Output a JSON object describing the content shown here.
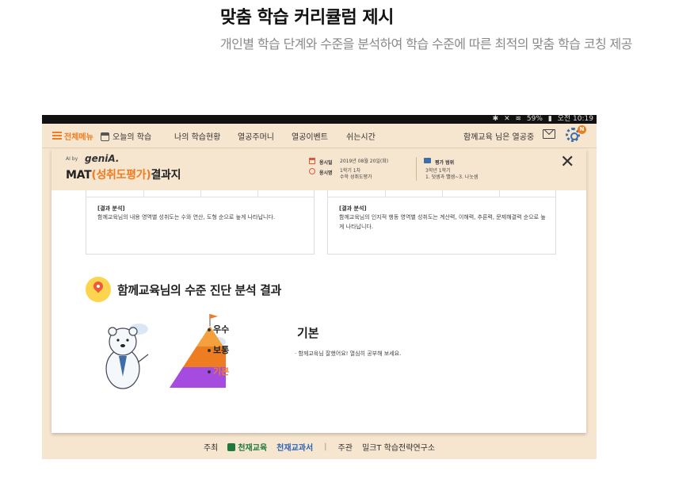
{
  "headline": "맞춤 학습 커리큘럼 제시",
  "subhead": "개인별 학습 단계와 수준을 분석하여 학습 수준에 따른 최적의 맞춤 학습 코칭 제공",
  "statusbar": {
    "battery": "59%",
    "time": "오전 10:19"
  },
  "nav": {
    "menu_label": "전체메뉴",
    "items": [
      "오늘의 학습",
      "나의 학습현황",
      "열공주머니",
      "열공이벤트",
      "쉬는시간"
    ],
    "user_greeting": "함께교육 님은 열공중",
    "notification_badge": "N"
  },
  "report": {
    "brand_small": "AI by",
    "brand_logo": "geniA.",
    "title_prefix": "MAT",
    "title_accent": "(성취도평가)",
    "title_suffix": "결과지",
    "exam_date_label": "응시일",
    "exam_date": "2019년 08월 20일(화)",
    "exam_name_label": "응시명",
    "exam_name_line1": "1학기 1차",
    "exam_name_line2": "수학 성취도평가",
    "range_label": "평가 범위",
    "range_line1": "3학년 1학기",
    "range_line2": "1. 덧셈과 뺄셈~3. 나눗셈",
    "close_symbol": "✕"
  },
  "cards": [
    {
      "label": "[결과 분석]",
      "text": "함께교육님의 내용 영역별 성취도는 수와 연산, 도형 순으로 높게 나타납니다."
    },
    {
      "label": "[결과 분석]",
      "text": "함께교육님의 인지적 행동 영역별 성취도는 계산력, 이해력, 추론력, 문제해결력 순으로 높게 나타납니다."
    }
  ],
  "section_title": "함께교육님의 수준 진단 분석 결과",
  "levels": [
    {
      "label": "우수",
      "active": false
    },
    {
      "label": "보통",
      "active": false
    },
    {
      "label": "기본",
      "active": true
    }
  ],
  "result": {
    "level": "기본",
    "text": "· 함께교육님 잘했어요! 열심히 공부해 보세요."
  },
  "footer": {
    "host_label": "주최",
    "host_logo1": "천재교육",
    "host_logo2": "천재교과서",
    "separator": "|",
    "organizer_label": "주관",
    "organizer": "밀크T 학습전략연구소"
  },
  "colors": {
    "accent": "#ee7d22",
    "bg": "#f6e5cf",
    "purple": "#a64be0",
    "yellow": "#fcd44e"
  }
}
